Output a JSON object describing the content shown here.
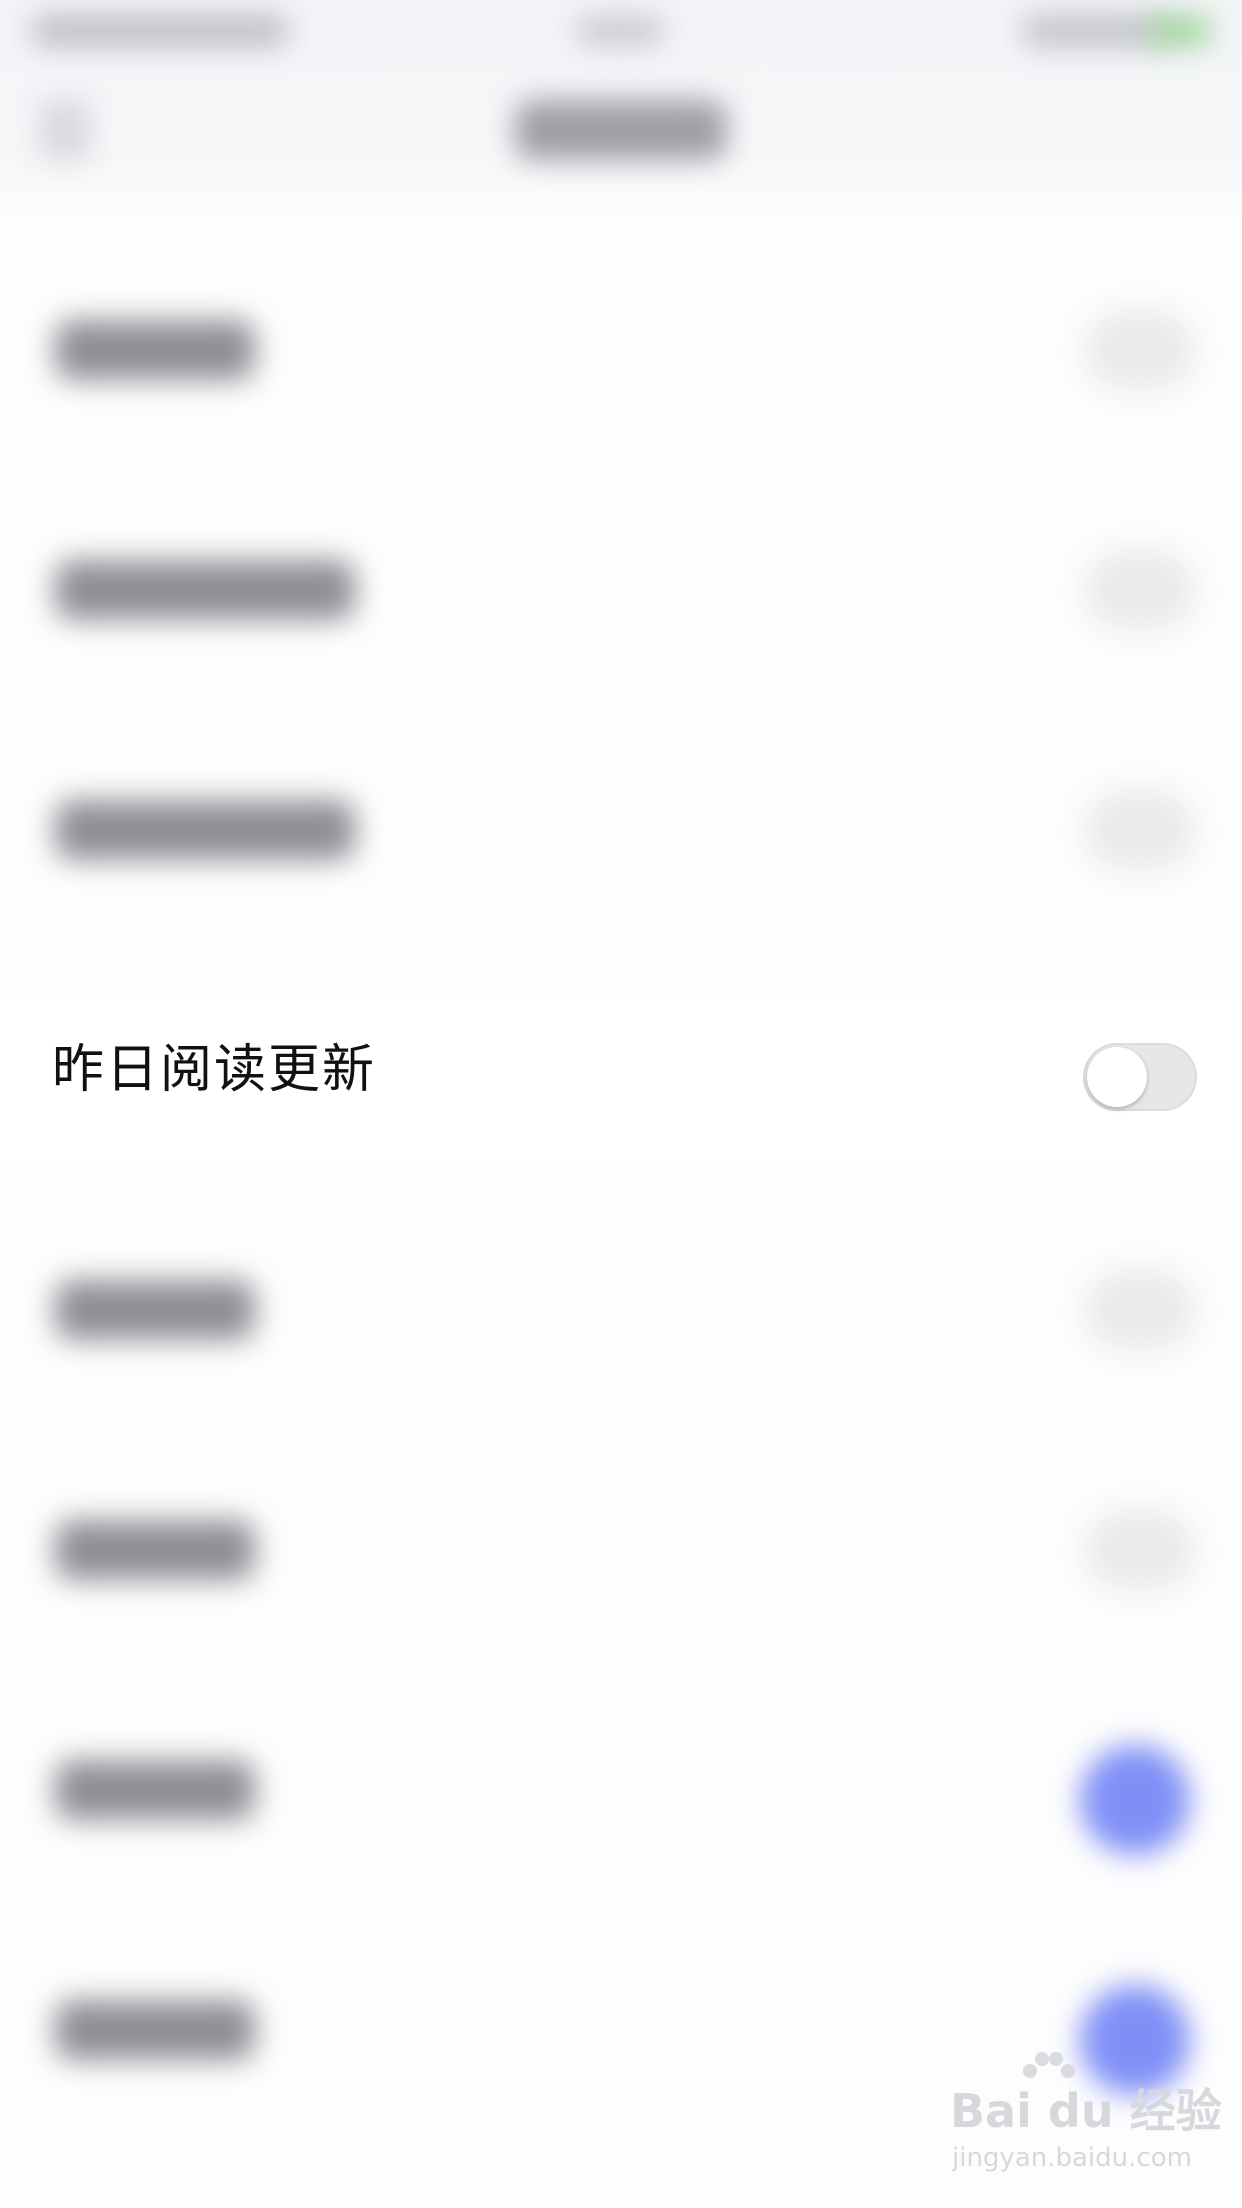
{
  "settings": {
    "focused_item": {
      "label": "昨日阅读更新",
      "toggle_on": false
    }
  },
  "watermark": {
    "logo_text": "Bai du 经验",
    "url_text": "jingyan.baidu.com"
  },
  "colors": {
    "accent_blue": "#7f8ff5",
    "toggle_off_track": "#e7e7ea",
    "background": "#fdfdfe"
  }
}
